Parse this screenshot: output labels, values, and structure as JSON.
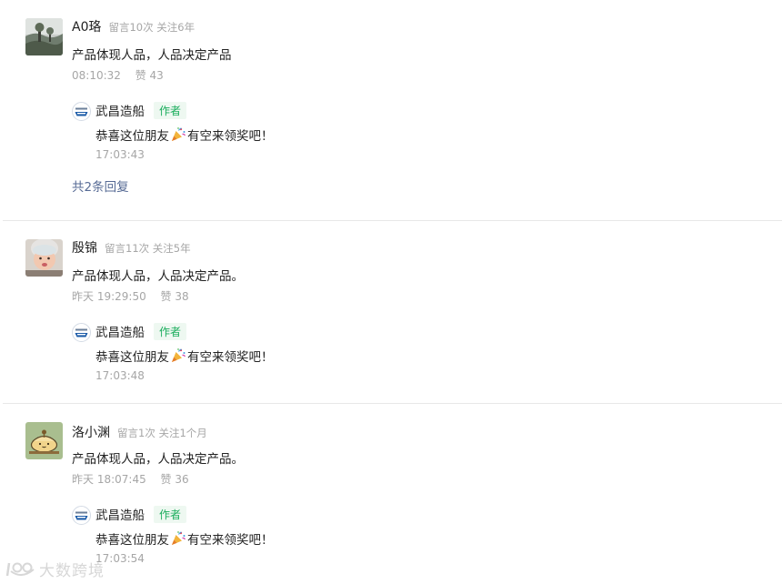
{
  "comments": [
    {
      "name": "A0珞",
      "user_meta": "留言10次 关注6年",
      "content": "产品体现人品，人品决定产品",
      "time": "08:10:32",
      "likes": "赞 43",
      "reply": {
        "name": "武昌造船",
        "badge": "作者",
        "text_before": "恭喜这位朋友",
        "text_after": "有空来领奖吧！",
        "time": "17:03:43"
      },
      "more_replies": "共2条回复"
    },
    {
      "name": "殷锦",
      "user_meta": "留言11次 关注5年",
      "content": "产品体现人品，人品决定产品。",
      "time": "昨天 19:29:50",
      "likes": "赞 38",
      "reply": {
        "name": "武昌造船",
        "badge": "作者",
        "text_before": "恭喜这位朋友",
        "text_after": "有空来领奖吧！",
        "time": "17:03:48"
      }
    },
    {
      "name": "洛小渊",
      "user_meta": "留言1次 关注1个月",
      "content": "产品体现人品，人品决定产品。",
      "time": "昨天 18:07:45",
      "likes": "赞 36",
      "reply": {
        "name": "武昌造船",
        "badge": "作者",
        "text_before": "恭喜这位朋友",
        "text_after": "有空来领奖吧！",
        "time": "17:03:54"
      }
    }
  ],
  "icons": {
    "avatar_1": "landscape-photo-avatar",
    "avatar_2": "baby-photo-avatar",
    "avatar_3": "cartoon-pudding-avatar",
    "author_logo": "shipyard-logo-icon",
    "emoji": "party-popper-icon"
  },
  "colors": {
    "author_badge": "#1aad5c",
    "link": "#576b95",
    "meta_text": "#a6a6a6"
  },
  "watermark": {
    "text": "大数跨境"
  }
}
